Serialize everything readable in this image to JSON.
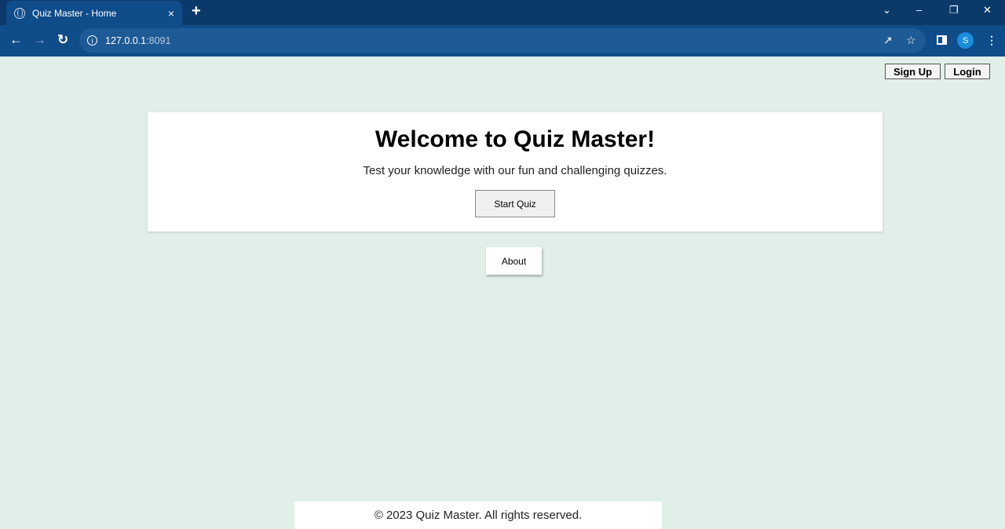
{
  "browser": {
    "tab_title": "Quiz Master - Home",
    "tab_close": "×",
    "new_tab": "+",
    "url_host": "127.0.0.1",
    "url_port": ":8091",
    "profile_initial": "S"
  },
  "header": {
    "signup_label": "Sign Up",
    "login_label": "Login"
  },
  "hero": {
    "title": "Welcome to Quiz Master!",
    "subtitle": "Test your knowledge with our fun and challenging quizzes.",
    "start_label": "Start Quiz"
  },
  "about_label": "About",
  "footer": {
    "text": "© 2023 Quiz Master. All rights reserved."
  }
}
